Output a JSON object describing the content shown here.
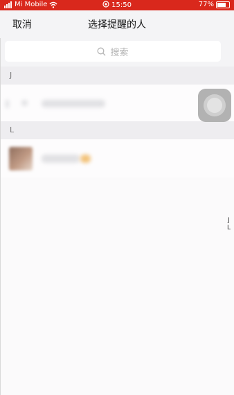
{
  "status_bar": {
    "carrier": "Mi Mobile",
    "time": "15:50",
    "battery_percent": "77%",
    "background_color": "#d9281c"
  },
  "nav": {
    "cancel_label": "取消",
    "title": "选择提醒的人"
  },
  "search": {
    "placeholder": "搜索"
  },
  "sections": [
    {
      "letter": "J"
    },
    {
      "letter": "L"
    }
  ],
  "index_bar": [
    "J",
    "L"
  ],
  "icons": {
    "signal": "signal-bars-icon",
    "wifi": "wifi-icon",
    "alarm": "alarm-icon",
    "battery": "battery-icon",
    "search": "search-icon",
    "assistive_touch": "assistive-touch-icon"
  }
}
